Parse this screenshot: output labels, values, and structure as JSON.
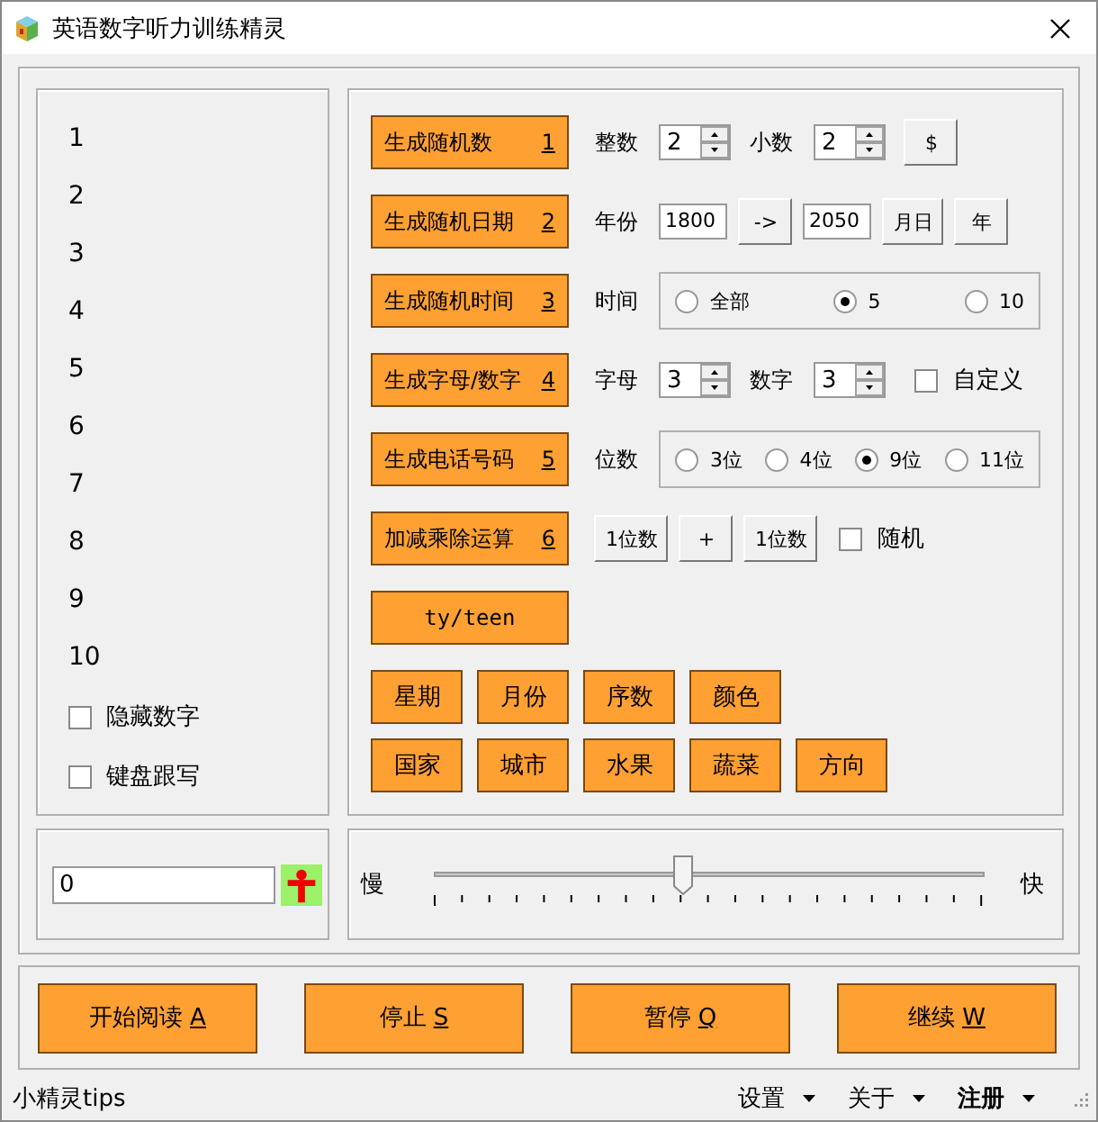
{
  "window": {
    "title": "英语数字听力训练精灵"
  },
  "number_list": [
    "1",
    "2",
    "3",
    "4",
    "5",
    "6",
    "7",
    "8",
    "9",
    "10"
  ],
  "left_options": [
    {
      "label": "隐藏数字",
      "checked": false
    },
    {
      "label": "键盘跟写",
      "checked": false
    }
  ],
  "count_field": {
    "value": "0"
  },
  "generators": [
    {
      "label": "生成随机数",
      "hotkey": "1",
      "controls": [
        {
          "kind": "label",
          "text": "整数"
        },
        {
          "kind": "spinner",
          "value": "2"
        },
        {
          "kind": "label",
          "text": "小数"
        },
        {
          "kind": "spinner",
          "value": "2"
        },
        {
          "kind": "button",
          "text": "$"
        }
      ]
    },
    {
      "label": "生成随机日期",
      "hotkey": "2",
      "controls": [
        {
          "kind": "label",
          "text": "年份"
        },
        {
          "kind": "field",
          "value": "1800"
        },
        {
          "kind": "button",
          "text": "->"
        },
        {
          "kind": "field",
          "value": "2050"
        },
        {
          "kind": "button",
          "text": "月日"
        },
        {
          "kind": "button",
          "text": "年"
        }
      ]
    },
    {
      "label": "生成随机时间",
      "hotkey": "3",
      "controls": [
        {
          "kind": "label",
          "text": "时间"
        },
        {
          "kind": "radios",
          "options": [
            {
              "label": "全部",
              "selected": false
            },
            {
              "label": "5",
              "selected": true
            },
            {
              "label": "10",
              "selected": false
            }
          ]
        }
      ]
    },
    {
      "label": "生成字母/数字",
      "hotkey": "4",
      "controls": [
        {
          "kind": "label",
          "text": "字母"
        },
        {
          "kind": "spinner",
          "value": "3"
        },
        {
          "kind": "label",
          "text": "数字"
        },
        {
          "kind": "spinner",
          "value": "3"
        },
        {
          "kind": "checkbox",
          "text": "自定义",
          "checked": false
        }
      ]
    },
    {
      "label": "生成电话号码",
      "hotkey": "5",
      "controls": [
        {
          "kind": "label",
          "text": "位数"
        },
        {
          "kind": "radios",
          "options": [
            {
              "label": "3位",
              "selected": false
            },
            {
              "label": "4位",
              "selected": false
            },
            {
              "label": "9位",
              "selected": true
            },
            {
              "label": "11位",
              "selected": false
            }
          ]
        }
      ]
    },
    {
      "label": "加减乘除运算",
      "hotkey": "6",
      "controls": [
        {
          "kind": "button",
          "text": "1位数"
        },
        {
          "kind": "button",
          "text": "+"
        },
        {
          "kind": "button",
          "text": "1位数"
        },
        {
          "kind": "checkbox",
          "text": "随机",
          "checked": false
        }
      ]
    },
    {
      "label": "ty/teen"
    }
  ],
  "categories": [
    [
      "星期",
      "月份",
      "序数",
      "颜色"
    ],
    [
      "国家",
      "城市",
      "水果",
      "蔬菜",
      "方向"
    ]
  ],
  "speed": {
    "slow": "慢",
    "fast": "快",
    "level": 0.45
  },
  "actions": [
    {
      "label": "开始阅读",
      "hotkey": "A"
    },
    {
      "label": "停止",
      "hotkey": "S"
    },
    {
      "label": "暂停",
      "hotkey": "Q"
    },
    {
      "label": "继续",
      "hotkey": "W"
    }
  ],
  "status_bar": {
    "tips": "小精灵tips",
    "menus": [
      {
        "label": "设置",
        "bold": false
      },
      {
        "label": "关于",
        "bold": false
      },
      {
        "label": "注册",
        "bold": true
      }
    ]
  }
}
